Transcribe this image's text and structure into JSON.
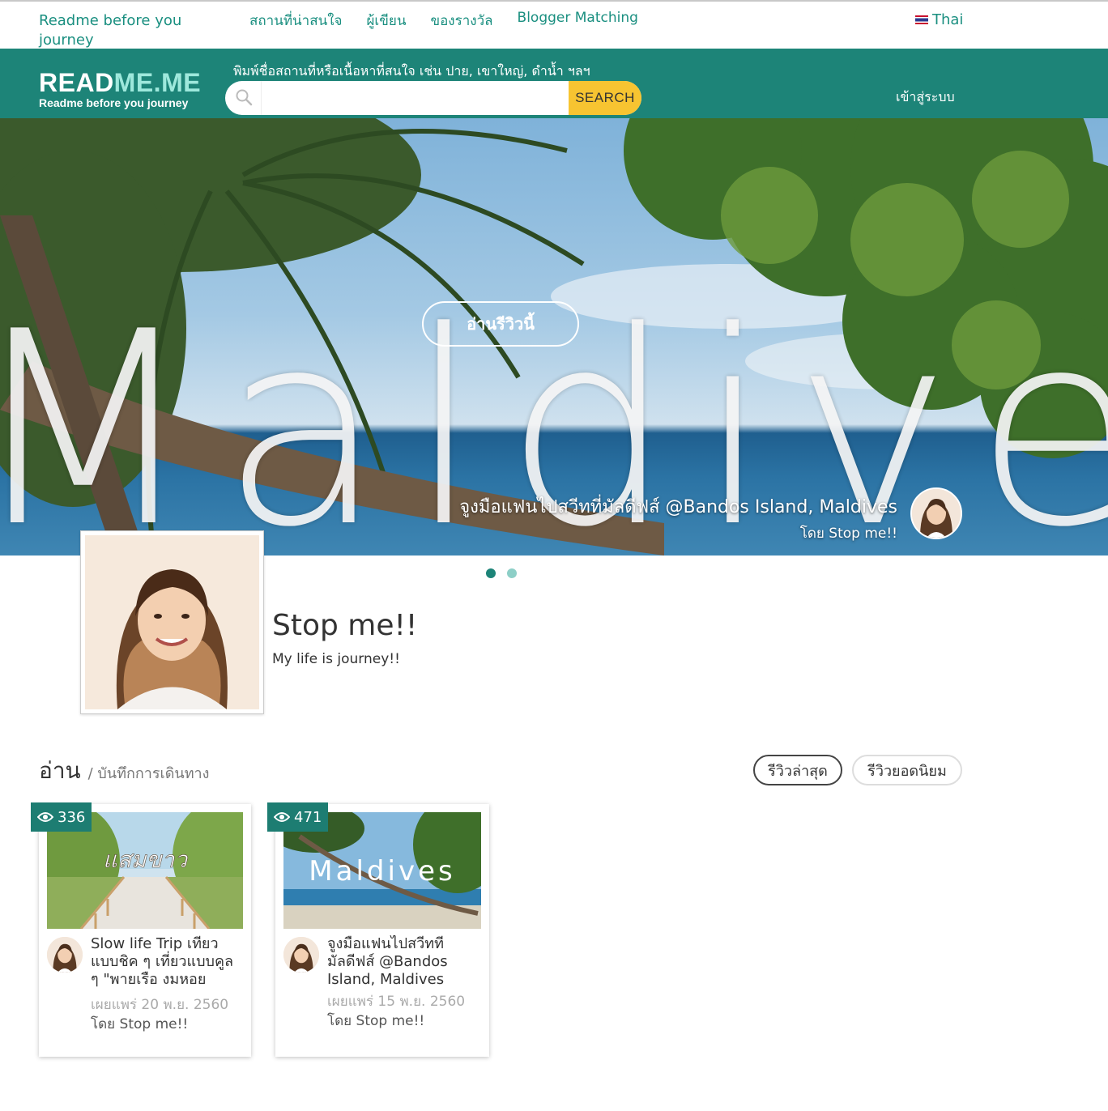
{
  "topbar": {
    "tagline": "Readme before you journey",
    "nav": [
      "สถานที่น่าสนใจ",
      "ผู้เขียน",
      "ของรางวัล",
      "Blogger Matching"
    ],
    "language": "Thai"
  },
  "header": {
    "logo_main": "READ",
    "logo_accent": "ME.ME",
    "logo_sub": "Readme before you journey",
    "search_hint": "พิมพ์ชื่อสถานที่หรือเนื้อหาที่สนใจ เช่น ปาย, เขาใหญ่, ดำน้ำ ฯลฯ",
    "search_value": "",
    "search_button": "SEARCH",
    "login": "เข้าสู่ระบบ"
  },
  "hero": {
    "word": "Maldives",
    "read_button": "อ่านรีวิวนี้",
    "caption_title": "จูงมือแฟนไปสวีทที่มัลดีฟส์ @Bandos Island, Maldives",
    "caption_by": "โดย Stop me!!",
    "slides": 2,
    "active_slide": 1
  },
  "profile": {
    "name": "Stop me!!",
    "bio": "My life is journey!!"
  },
  "section": {
    "title": "อ่าน",
    "subtitle": "/ บันทึกการเดินทาง",
    "filter_latest": "รีวิวล่าสุด",
    "filter_popular": "รีวิวยอดนิยม"
  },
  "cards": [
    {
      "views": "336",
      "thumb_text": "แสมขาว",
      "title": "Slow life Trip เที่ยวแบบชิค ๆ เที่ยวแบบคูล ๆ \"พายเรือ งมหอย",
      "date": "เผยแพร่ 20 พ.ย. 2560",
      "by": "โดย Stop me!!"
    },
    {
      "views": "471",
      "thumb_text": "Maldives",
      "title": "จูงมือแฟนไปสวีทที่มัลดีฟส์ @Bandos Island, Maldives",
      "date": "เผยแพร่ 15 พ.ย. 2560",
      "by": "โดย Stop me!!"
    }
  ],
  "colors": {
    "brand": "#1d8478",
    "search_button": "#f7c431",
    "link": "#1a8f80"
  }
}
